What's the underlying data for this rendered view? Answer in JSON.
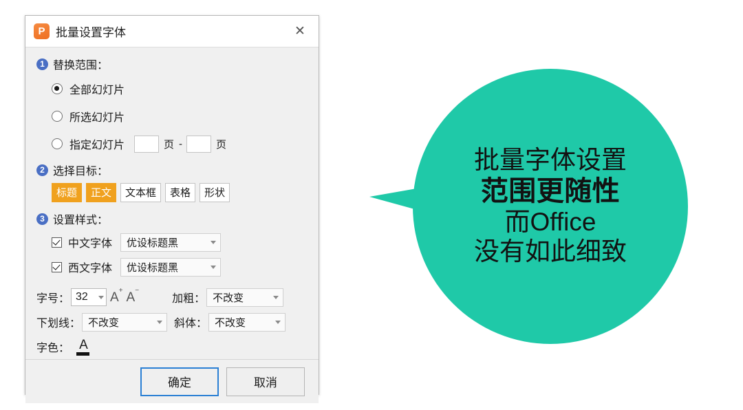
{
  "dialog": {
    "title": "批量设置字体",
    "app_icon": "P",
    "close_icon": "✕",
    "sections": [
      {
        "badge": "1",
        "label": "替换范围："
      },
      {
        "badge": "2",
        "label": "选择目标："
      },
      {
        "badge": "3",
        "label": "设置样式："
      }
    ],
    "scope": {
      "options": [
        {
          "label": "全部幻灯片",
          "selected": true
        },
        {
          "label": "所选幻灯片",
          "selected": false
        },
        {
          "label": "指定幻灯片",
          "selected": false
        }
      ],
      "page_from": "",
      "page_to": "",
      "page_unit": "页",
      "range_dash": "-"
    },
    "targets": [
      {
        "label": "标题",
        "selected": true
      },
      {
        "label": "正文",
        "selected": true
      },
      {
        "label": "文本框",
        "selected": false
      },
      {
        "label": "表格",
        "selected": false
      },
      {
        "label": "形状",
        "selected": false
      }
    ],
    "style": {
      "cn_font": {
        "label": "中文字体",
        "checked": true,
        "value": "优设标题黑"
      },
      "en_font": {
        "label": "西文字体",
        "checked": true,
        "value": "优设标题黑"
      },
      "font_size": {
        "label": "字号：",
        "value": "32",
        "increase_icon": "A",
        "decrease_icon": "A"
      },
      "bold": {
        "label": "加粗：",
        "value": "不改变"
      },
      "underline": {
        "label": "下划线：",
        "value": "不改变"
      },
      "italic": {
        "label": "斜体：",
        "value": "不改变"
      },
      "font_color": {
        "label": "字色：",
        "icon_letter": "A"
      }
    },
    "footer": {
      "ok_label": "确定",
      "cancel_label": "取消"
    }
  },
  "bubble": {
    "color": "#1FC9A8",
    "lines": [
      "批量字体设置",
      "范围更随性",
      "而Office",
      "没有如此细致"
    ]
  }
}
